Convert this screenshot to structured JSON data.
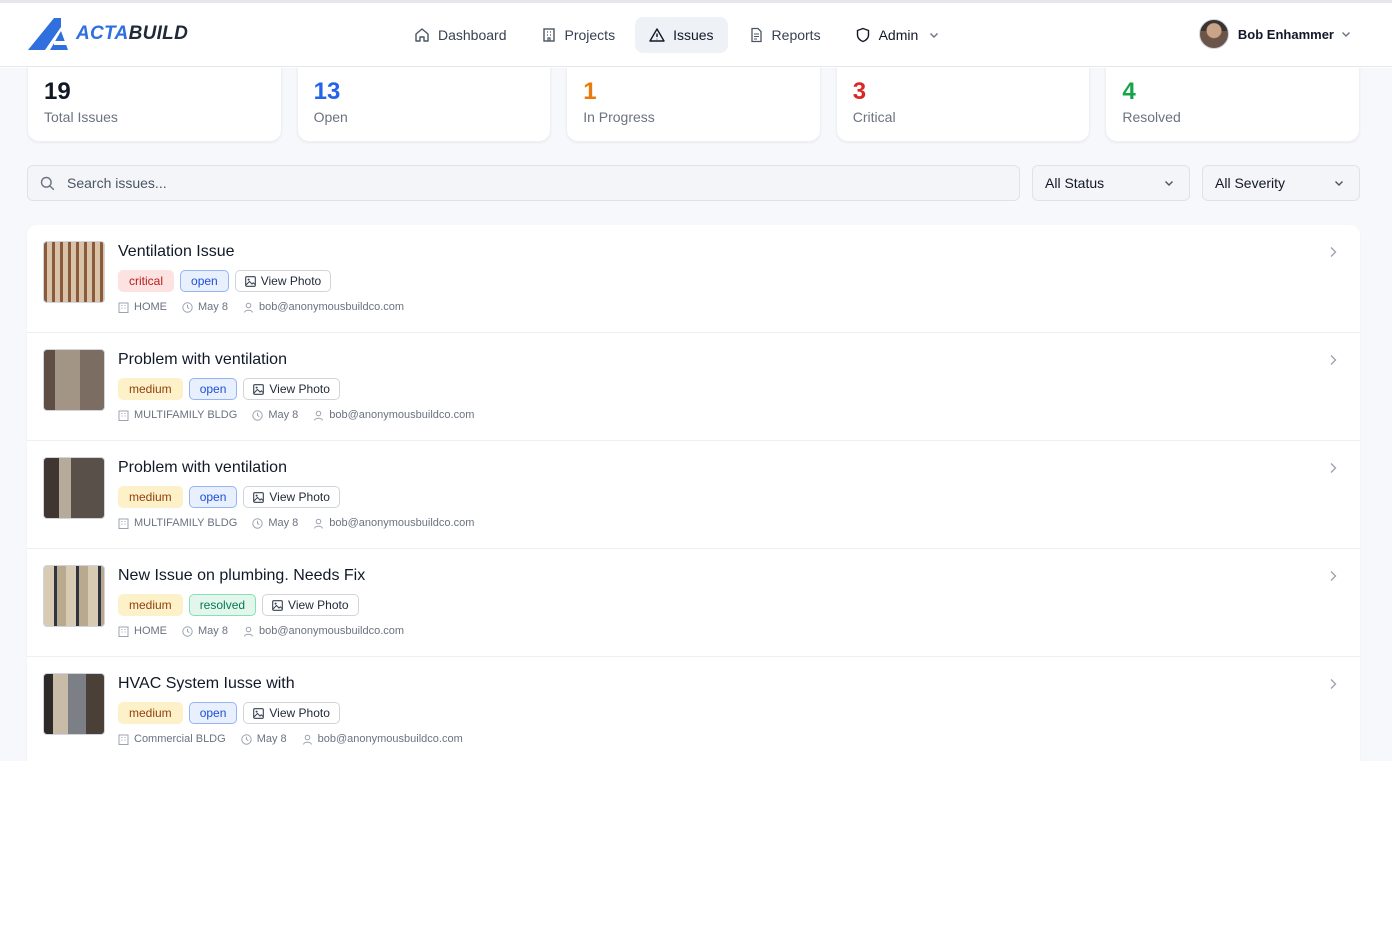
{
  "app": {
    "logo_part1": "ACTA",
    "logo_part2": "BUILD",
    "brand_color": "#2f6fde"
  },
  "nav": [
    {
      "label": "Dashboard",
      "icon": "home-icon",
      "active": false
    },
    {
      "label": "Projects",
      "icon": "building-icon",
      "active": false
    },
    {
      "label": "Issues",
      "icon": "warning-triangle-icon",
      "active": true
    },
    {
      "label": "Reports",
      "icon": "document-icon",
      "active": false
    },
    {
      "label": "Admin",
      "icon": "shield-icon",
      "active": false
    }
  ],
  "user": {
    "name": "Bob Enhammer"
  },
  "stats": [
    {
      "value": "19",
      "label": "Total Issues",
      "color": "#111827"
    },
    {
      "value": "13",
      "label": "Open",
      "color": "#2563eb"
    },
    {
      "value": "1",
      "label": "In Progress",
      "color": "#ea7a0c"
    },
    {
      "value": "3",
      "label": "Critical",
      "color": "#dc2626"
    },
    {
      "value": "4",
      "label": "Resolved",
      "color": "#16a34a"
    }
  ],
  "search": {
    "placeholder": "Search issues..."
  },
  "filters": {
    "status": "All Status",
    "severity": "All Severity"
  },
  "issues": [
    {
      "title": "Ventilation Issue",
      "severity": "critical",
      "status": "open",
      "photo_label": "View Photo",
      "project": "HOME",
      "date": "May 8",
      "user": "bob@anonymousbuildco.com"
    },
    {
      "title": "Problem with ventilation",
      "severity": "medium",
      "status": "open",
      "photo_label": "View Photo",
      "project": "MULTIFAMILY BLDG",
      "date": "May 8",
      "user": "bob@anonymousbuildco.com"
    },
    {
      "title": "Problem with ventilation",
      "severity": "medium",
      "status": "open",
      "photo_label": "View Photo",
      "project": "MULTIFAMILY BLDG",
      "date": "May 8",
      "user": "bob@anonymousbuildco.com"
    },
    {
      "title": "New Issue on plumbing. Needs Fix",
      "severity": "medium",
      "status": "resolved",
      "photo_label": "View Photo",
      "project": "HOME",
      "date": "May 8",
      "user": "bob@anonymousbuildco.com"
    },
    {
      "title": "HVAC System Iusse with",
      "severity": "medium",
      "status": "open",
      "photo_label": "View Photo",
      "project": "Commercial BLDG",
      "date": "May 8",
      "user": "bob@anonymousbuildco.com"
    }
  ]
}
